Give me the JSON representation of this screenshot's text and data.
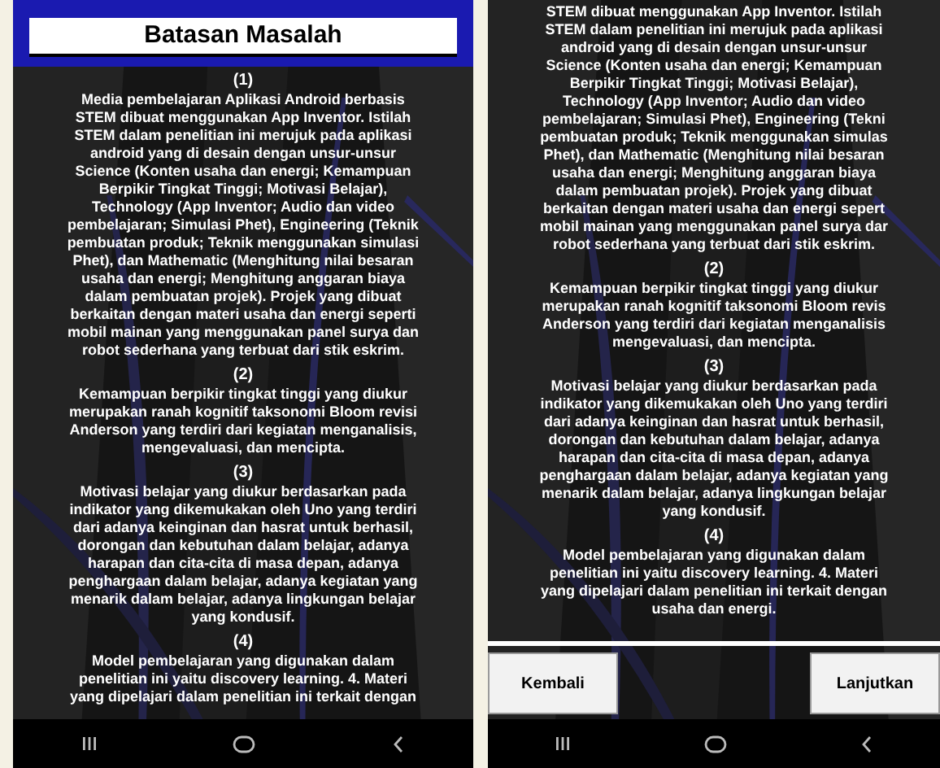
{
  "screens": [
    {
      "title": "Batasan Masalah",
      "blocks": [
        {
          "kind": "number",
          "lines": [
            "(1)"
          ]
        },
        {
          "kind": "paragraph",
          "lines": [
            "Media pembelajaran Aplikasi Android berbasis",
            "STEM dibuat menggunakan App Inventor. Istilah",
            "STEM dalam penelitian ini merujuk pada aplikasi",
            "android yang di desain dengan unsur-unsur",
            "Science (Konten usaha dan energi; Kemampuan",
            "Berpikir Tingkat Tinggi; Motivasi Belajar),",
            "Technology (App Inventor; Audio dan video",
            "pembelajaran; Simulasi Phet), Engineering (Teknik",
            "pembuatan produk; Teknik menggunakan simulasi",
            "Phet), dan Mathematic (Menghitung nilai besaran",
            "usaha dan energi; Menghitung anggaran biaya",
            "dalam pembuatan projek). Projek yang dibuat",
            "berkaitan dengan materi usaha dan energi seperti",
            "mobil mainan yang menggunakan panel surya dan",
            "robot sederhana yang terbuat dari stik eskrim."
          ]
        },
        {
          "kind": "number",
          "lines": [
            "(2)"
          ]
        },
        {
          "kind": "paragraph",
          "lines": [
            "Kemampuan berpikir tingkat tinggi yang diukur",
            "merupakan ranah kognitif taksonomi Bloom revisi",
            "Anderson yang terdiri dari kegiatan menganalisis,",
            "mengevaluasi, dan mencipta."
          ]
        },
        {
          "kind": "number",
          "lines": [
            "(3)"
          ]
        },
        {
          "kind": "paragraph",
          "lines": [
            "Motivasi belajar yang diukur berdasarkan pada",
            "indikator yang dikemukakan oleh Uno yang terdiri",
            "dari adanya keinginan dan hasrat untuk berhasil,",
            "dorongan dan kebutuhan dalam belajar, adanya",
            "harapan dan cita-cita di masa depan, adanya",
            "penghargaan dalam belajar, adanya kegiatan yang",
            "menarik dalam belajar, adanya lingkungan belajar",
            "yang kondusif."
          ]
        },
        {
          "kind": "number",
          "lines": [
            "(4)"
          ]
        },
        {
          "kind": "paragraph",
          "lines": [
            "Model pembelajaran yang digunakan dalam",
            "penelitian ini yaitu discovery learning. 4. Materi",
            "yang dipelajari dalam penelitian ini terkait dengan"
          ]
        }
      ]
    },
    {
      "blocks": [
        {
          "kind": "paragraph",
          "lines": [
            "STEM dibuat menggunakan App Inventor. Istilah",
            "STEM dalam penelitian ini merujuk pada aplikasi",
            "android yang di desain dengan unsur-unsur",
            "Science (Konten usaha dan energi; Kemampuan",
            "Berpikir Tingkat Tinggi; Motivasi Belajar),",
            "Technology (App Inventor; Audio dan video",
            "pembelajaran; Simulasi Phet), Engineering (Tekni",
            "pembuatan produk; Teknik menggunakan simulas",
            "Phet), dan Mathematic (Menghitung nilai besaran",
            "usaha dan energi; Menghitung anggaran biaya",
            "dalam pembuatan projek). Projek yang dibuat",
            "berkaitan dengan materi usaha dan energi sepert",
            "mobil mainan yang menggunakan panel surya dar",
            "robot sederhana yang terbuat dari stik eskrim."
          ]
        },
        {
          "kind": "number",
          "lines": [
            "(2)"
          ]
        },
        {
          "kind": "paragraph",
          "lines": [
            "Kemampuan berpikir tingkat tinggi yang diukur",
            "merupakan ranah kognitif taksonomi Bloom revis",
            "Anderson yang terdiri dari kegiatan menganalisis",
            "mengevaluasi, dan mencipta."
          ]
        },
        {
          "kind": "number",
          "lines": [
            "(3)"
          ]
        },
        {
          "kind": "paragraph",
          "lines": [
            "Motivasi belajar yang diukur berdasarkan pada",
            "indikator yang dikemukakan oleh Uno yang terdiri",
            "dari adanya keinginan dan hasrat untuk berhasil,",
            "dorongan dan kebutuhan dalam belajar, adanya",
            "harapan dan cita-cita di masa depan, adanya",
            "penghargaan dalam belajar, adanya kegiatan yang",
            "menarik dalam belajar, adanya lingkungan belajar",
            "yang kondusif."
          ]
        },
        {
          "kind": "number",
          "lines": [
            "(4)"
          ]
        },
        {
          "kind": "paragraph",
          "lines": [
            "Model pembelajaran yang digunakan dalam",
            "penelitian ini yaitu discovery learning. 4. Materi",
            "yang dipelajari dalam penelitian ini terkait dengan",
            "usaha dan energi."
          ]
        }
      ],
      "buttons": [
        {
          "label": "Kembali"
        },
        {
          "label": "Lanjutkan"
        }
      ]
    }
  ]
}
